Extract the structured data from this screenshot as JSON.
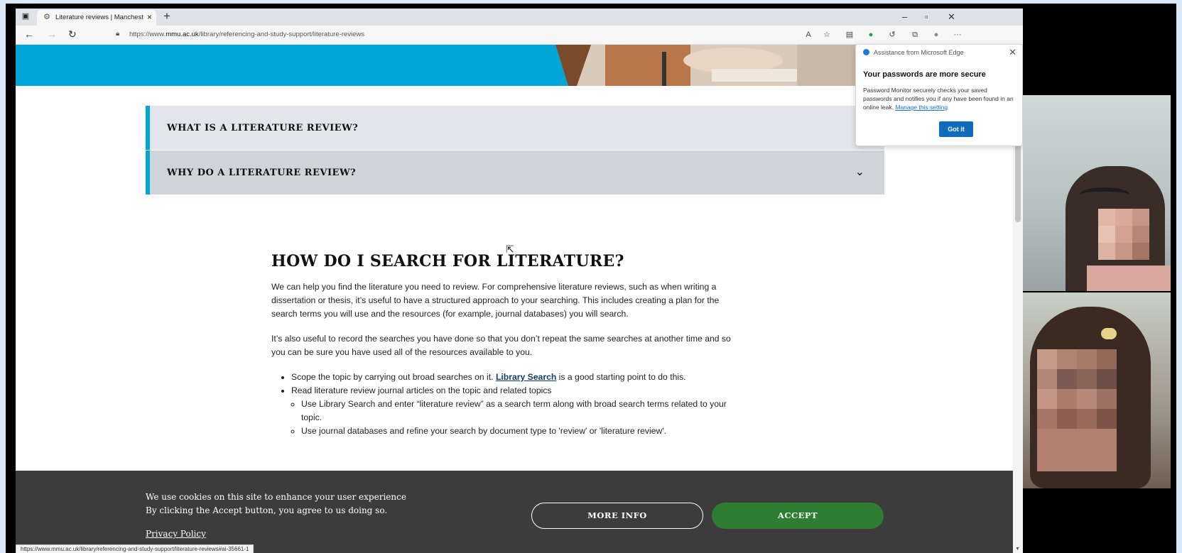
{
  "browser": {
    "tab_title": "Literature reviews | Manchester M",
    "tab_close": "×",
    "new_tab": "+",
    "window_min": "–",
    "window_restore": "▫",
    "window_close": "✕",
    "url_prefix": "https://www.",
    "url_domain": "mmu.ac.uk",
    "url_path": "/library/referencing-and-study-support/literature-reviews",
    "status_url": "https://www.mmu.ac.uk/library/referencing-and-study-support/literature-reviews#ai-35661-1"
  },
  "accordions": [
    {
      "label": "WHAT IS A LITERATURE REVIEW?"
    },
    {
      "label": "WHY DO A LITERATURE REVIEW?",
      "chevron": "⌄"
    }
  ],
  "main": {
    "heading": "HOW DO I SEARCH FOR LITERATURE?",
    "para1": "We can help you find the literature you need to review.  For comprehensive literature reviews, such as when writing a dissertation or thesis, it’s useful to have a structured approach to your searching.  This includes creating a plan for the search terms you will use and the resources (for example, journal databases) you will search.",
    "para2": "It’s also useful to record the searches you have done so that you don’t repeat the same searches at another time and so you can be sure you have used all of the resources available to you.",
    "bullet1_pre": "Scope the topic by carrying out broad searches on it. ",
    "bullet1_link": "Library Search",
    "bullet1_post": " is a good starting point to do this.",
    "bullet2": "Read literature review journal articles on the topic and related topics",
    "sub1": "Use Library Search and enter “literature review” as a search term along with broad search terms related to your topic.",
    "sub2": "Use journal databases and refine your search by document type to 'review' or 'literature review'."
  },
  "cookie": {
    "line1": "We use cookies on this site to enhance your user experience",
    "line2": "By clicking the Accept button, you agree to us doing so.",
    "privacy": "Privacy Policy",
    "more_info": "MORE INFO",
    "accept": "ACCEPT"
  },
  "popup": {
    "header": "Assistance from Microsoft Edge",
    "title": "Your passwords are more secure",
    "body": "Password Monitor securely checks your saved passwords and notifies you if any have been found in an online leak. ",
    "link": "Manage this setting",
    "button": "Got it"
  },
  "colors": {
    "accent_blue": "#00a6d6",
    "accept_green": "#2e7d32",
    "cookie_bg": "#3c3c3c",
    "accordion1_bg": "#e2e6ea",
    "accordion2_bg": "#cfd4d9"
  }
}
